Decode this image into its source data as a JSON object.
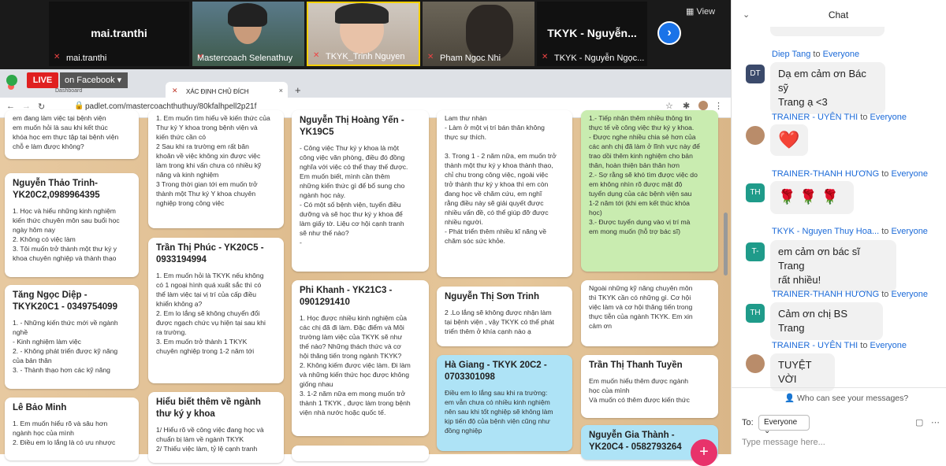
{
  "zoom": {
    "view_label": "View",
    "tiles": [
      {
        "label": "mai.tranthi",
        "big": "mai.tranthi"
      },
      {
        "label": "Mastercoach Selenathuy",
        "big": ""
      },
      {
        "label": "TKYK_Trinh Nguyen",
        "big": ""
      },
      {
        "label": "Pham Ngoc Nhi",
        "big": ""
      },
      {
        "label": "TKYK - Nguyễn Ngọc...",
        "big": "TKYK - Nguyễn..."
      }
    ]
  },
  "live": {
    "badge": "LIVE",
    "label": "on Facebook"
  },
  "browser": {
    "tab_title": "XÁC ĐỊNH CHỦ ĐÍCH",
    "dashboard": "Dashboard",
    "url": "padlet.com/mastercoachthuthuy/80kfalhpell2p21f"
  },
  "cards": [
    {
      "title": "",
      "body": "em đang làm việc tại bệnh viện\nem muốn hỏi là sau khi kết thúc\nkhóa học em thực tập tại bệnh viện\nchỗ e làm được không?"
    },
    {
      "title": "Nguyễn Thảo Trinh-\nYK20C2,0989964395",
      "body": "1. Học và hiểu những kinh nghiệm\nkiến thức chuyên môn sau buổi học\nngày hôm nay\n2. Không có việc làm\n3. Tôi muốn trở thành một thư ký y\nkhoa chuyên nghiệp và thành thạo"
    },
    {
      "title": "Tăng Ngọc Diệp -\nTKYK20C1 - 0349754099",
      "body": "1. - Những kiến thức mới về ngành\nnghề\n- Kinh nghiệm làm việc\n2. - Không phát triển được kỹ năng\ncủa bản thân\n3. - Thành thạo hơn các kỹ năng"
    },
    {
      "title": "Lê Bảo Minh",
      "body": "1. Em muốn hiểu rõ và sâu hơn\nngành học của mình\n2. Điều em lo lắng là có ưu nhược"
    },
    {
      "title": "",
      "body": "1. Em muốn tìm hiểu về kiến thức của\nThư ký Y khoa trong bệnh viện và\nkiến thức cần có\n2 Sau khi ra trường em rất băn\nkhoăn về việc không xin được việc\nlàm trong khi vấn chưa có nhiều kỹ\nnăng và kinh nghiệm\n3 Trong thời gian tới em muốn trở\nthành một Thư ký Y khoa chuyên\nnghiệp trong công việc"
    },
    {
      "title": "Trần Thị Phúc - YK20C5 -\n0933194994",
      "body": "1. Em muốn hỏi là TKYK nếu không\ncó 1 ngoại hình quá xuất sắc thì có\nthể làm việc tại vị trí của cấp điều\nkhiển không ạ?\n2. Em lo lắng sẽ không chuyển đổi\nđược ngạch chức vụ hiện tại sau khi\nra trường.\n3. Em muốn trở thành 1 TKYK\nchuyên nghiệp trong 1-2 năm tới"
    },
    {
      "title": "Hiểu biết thêm về ngành\nthư ký y khoa",
      "body": "1/ Hiểu rõ về công việc đang học và\nchuẩn bị làm về ngành TKYK\n2/ Thiếu việc làm, tỷ lệ cạnh tranh"
    },
    {
      "title": "Nguyễn Thị Hoàng Yến -\nYK19C5",
      "body": "- Công việc Thư ký y khoa là một\ncông việc văn phòng, điều đó đồng\nnghĩa với việc có thể thay thế được.\nEm muốn biết, mình cần thêm\nnhững kiến thức gì để bổ sung cho\nngành học này.\n- Có một số bệnh viện, tuyển điều\ndưỡng và sẽ học thư ký y khoa để\nlàm giấy tờ. Liệu cơ hội cạnh tranh\nsẽ như thế nào?\n-"
    },
    {
      "title": "Phi Khanh - YK21C3 -\n0901291410",
      "body": "1. Học được nhiều kinh nghiệm của\ncác chị đã đi làm. Đặc điểm và Môi\ntrường làm việc của TKYK sẽ như\nthế nào? Những thách thức và cơ\nhội thăng tiến trong ngành TKYK?\n2. Không kiếm được việc làm. Đi làm\nvà những kiến thức học được không\ngiống nhau\n3. 1-2 năm nữa em mong muốn trở\nthành 1 TKYK , được làm trong bệnh\nviện nhà nước hoặc quốc tế."
    },
    {
      "title": "",
      "body": "Lam thư nhàn\n- Làm ở một vị trí bán thân không\nthực sự thích.\n\n3. Trong 1 - 2 năm nữa, em muốn trở\nthành một thư ký y khoa thành thạo,\nchỉ chu trong công việc, ngoài việc\ntrở thành thư ký y khoa thì em còn\nđang học về chăm cứu, em nghĩ\nrằng điều này sẽ giải quyết được\nnhiều vấn đề, có thể giúp đỡ được\nnhiều người.\n- Phát triển thêm nhiều kĩ năng về\nchăm sóc sức khỏe."
    },
    {
      "title": "Nguyễn Thị Sơn Trinh",
      "body": "2 .Lo lắng sẽ không được nhận làm\ntại bệnh viện , vậy TKYK có thể phát\ntriển thêm ở khía cạnh nào ạ"
    },
    {
      "title": "Hà Giang - TKYK 20C2 -\n0703301098",
      "body": "Điều em lo lắng sau khi ra trường:\nem vẫn chưa có nhiều kinh nghiệm\nnên sau khi tốt nghiệp sẽ không làm\nkịp tiến độ của bệnh viện cũng như\nđồng nghiệp"
    },
    {
      "title": "",
      "body": "1.- Tiếp nhận thêm nhiều thông tin\nthực tế về công việc thư ký y khoa.\n- Được nghe nhiều chia sẻ hơn của\ncác anh chị đã làm ở lĩnh vực này để\ntrao dồi thêm kinh nghiệm cho bản\nthân, hoàn thiện bản thân hơn\n2.- Sợ rằng sẽ khó tìm được việc do\nem không nhìn rõ được mật độ\ntuyển dụng của các bệnh viện sau\n1-2 năm tới (khi em kết thúc khóa\nhọc)\n3.- Được tuyển dụng vào vị trí mà\nem mong muốn (hỗ trợ bác sĩ)"
    },
    {
      "title": "",
      "body": "Ngoài những kỹ năng chuyên môn\nthì TKYK cần có những gì. Cơ hội\nviệc làm và cơ hội thăng tiến trong\nthực tiễn của ngành TKYK. Em xin\ncảm ơn"
    },
    {
      "title": "Trần Thị Thanh Tuyền",
      "body": "Em muốn hiểu thêm được ngành\nhọc của mình\nVà muốn có thêm được kiến thức"
    },
    {
      "title": "Nguyễn Gia Thành -\nYK20C4 - 0582793264",
      "body": ""
    }
  ],
  "chat": {
    "title": "Chat",
    "to_word": "to",
    "messages": [
      {
        "avatar": "DT",
        "avatar_color": "#3b4a6b",
        "from": "Diep Tang",
        "target": "Everyone",
        "text": "Dạ em cảm ơn Bác sỹ\nTrang ạ <3"
      },
      {
        "avatar": "",
        "avatar_color": "#b98c6a",
        "from": "TRAINER - UYÊN THI",
        "target": "Everyone",
        "text": "❤️"
      },
      {
        "avatar": "TH",
        "avatar_color": "#1f9b8a",
        "from": "TRAINER-THANH HƯƠNG",
        "target": "Everyone",
        "text": "🌹 🌹 🌹"
      },
      {
        "avatar": "T-",
        "avatar_color": "#1f9b8a",
        "from": "TKYK - Nguyen Thuy Hoa...",
        "target": "Everyone",
        "text": "em cảm ơn bác sĩ Trang\nrất nhiều!"
      },
      {
        "avatar": "TH",
        "avatar_color": "#1f9b8a",
        "from": "TRAINER-THANH HƯƠNG",
        "target": "Everyone",
        "text": "Cảm ơn chị BS Trang"
      },
      {
        "avatar": "",
        "avatar_color": "#b98c6a",
        "from": "TRAINER - UYÊN THI",
        "target": "Everyone",
        "text": "TUYỆT VỜI"
      }
    ],
    "who_can_see": "Who can see your messages?",
    "to_label": "To:",
    "recipient": "Everyone",
    "placeholder": "Type message here..."
  }
}
